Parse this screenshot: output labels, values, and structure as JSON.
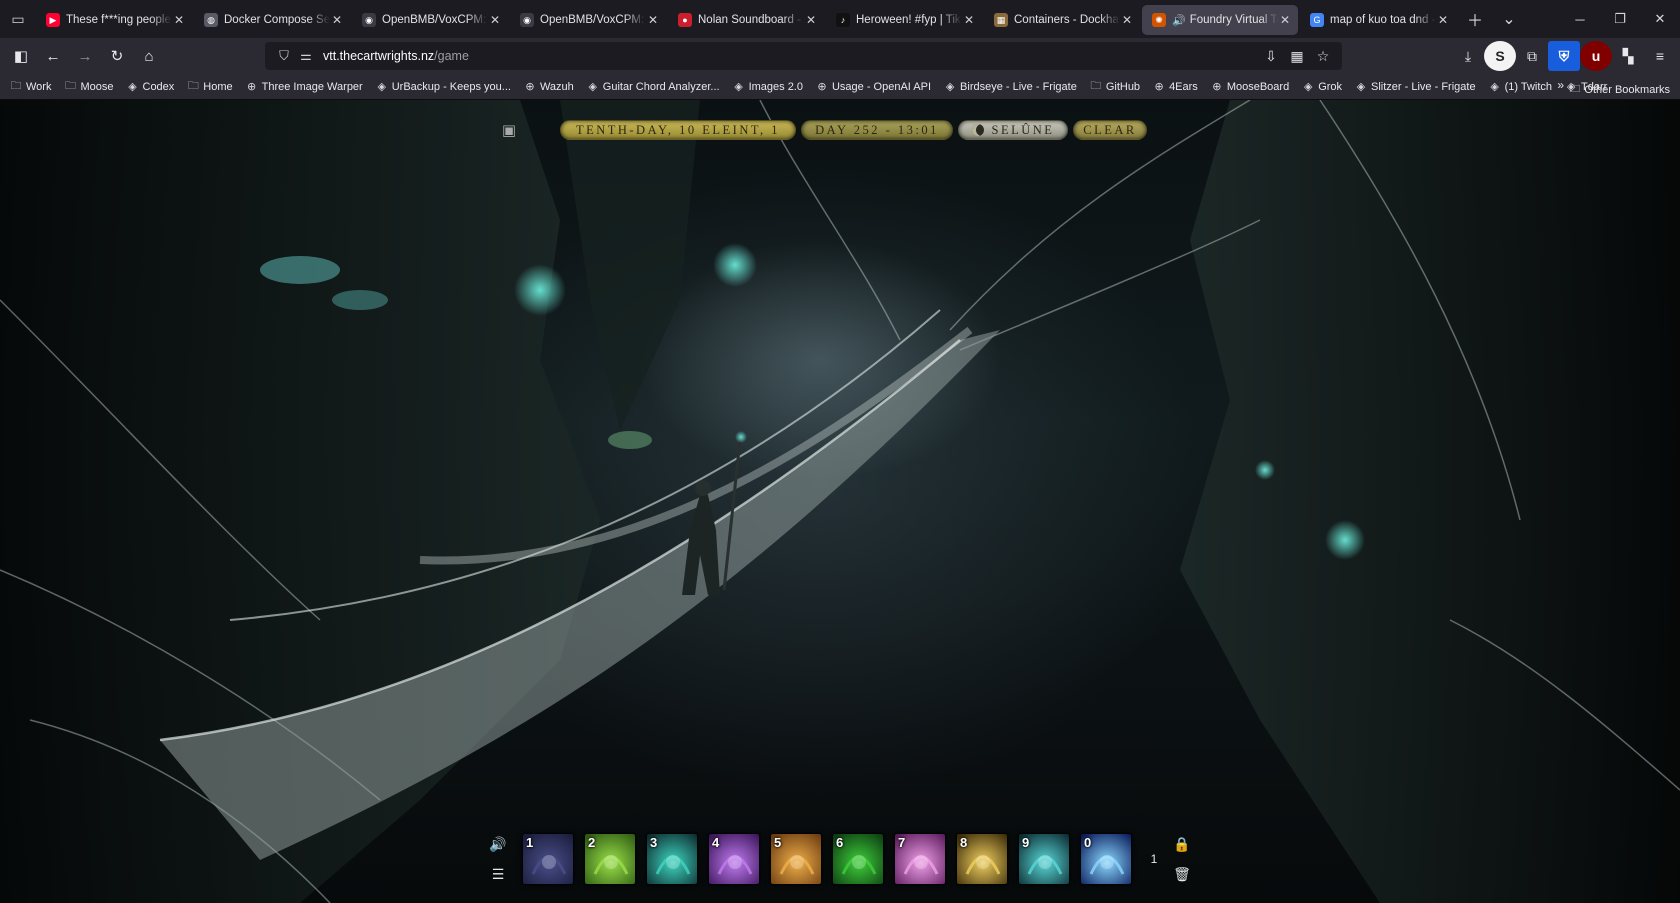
{
  "browser": {
    "tabs": [
      {
        "title": "These f***ing people, n",
        "favicon_color": "#ff0033",
        "favicon_glyph": "▶"
      },
      {
        "title": "Docker Compose Setup",
        "favicon_color": "#5a5a66",
        "favicon_glyph": "◍"
      },
      {
        "title": "OpenBMB/VoxCPM: Vo",
        "favicon_color": "#3a3a44",
        "favicon_glyph": "◉"
      },
      {
        "title": "OpenBMB/VoxCPM: Vo",
        "favicon_color": "#3a3a44",
        "favicon_glyph": "◉"
      },
      {
        "title": "Nolan Soundboard - In",
        "favicon_color": "#cc1f2d",
        "favicon_glyph": "●"
      },
      {
        "title": "Heroween! #fyp | TikTo",
        "favicon_color": "#111111",
        "favicon_glyph": "♪"
      },
      {
        "title": "Containers - Dockhand",
        "favicon_color": "#8a6a3a",
        "favicon_glyph": "▦"
      },
      {
        "title": "Foundry Virtual Tab",
        "favicon_color": "#d35400",
        "favicon_glyph": "✺",
        "active": true,
        "playing_audio": true
      },
      {
        "title": "map of kuo toa dnd - G",
        "favicon_color": "#4285f4",
        "favicon_glyph": "G"
      }
    ],
    "url_host": "vtt.thecartwrights.nz",
    "url_path": "/game",
    "bookmarks": [
      {
        "label": "Work",
        "icon": "folder-icon"
      },
      {
        "label": "Moose",
        "icon": "folder-icon"
      },
      {
        "label": "Codex",
        "icon": "app-icon"
      },
      {
        "label": "Home",
        "icon": "folder-icon"
      },
      {
        "label": "Three Image Warper",
        "icon": "globe-icon"
      },
      {
        "label": "UrBackup - Keeps you...",
        "icon": "app-icon"
      },
      {
        "label": "Wazuh",
        "icon": "globe-icon"
      },
      {
        "label": "Guitar Chord Analyzer...",
        "icon": "app-icon"
      },
      {
        "label": "Images 2.0",
        "icon": "app-icon"
      },
      {
        "label": "Usage - OpenAI API",
        "icon": "globe-icon"
      },
      {
        "label": "Birdseye - Live - Frigate",
        "icon": "app-icon"
      },
      {
        "label": "GitHub",
        "icon": "folder-icon"
      },
      {
        "label": "4Ears",
        "icon": "globe-icon"
      },
      {
        "label": "MooseBoard",
        "icon": "globe-icon"
      },
      {
        "label": "Grok",
        "icon": "app-icon"
      },
      {
        "label": "Slitzer - Live - Frigate",
        "icon": "app-icon"
      },
      {
        "label": "(1) Twitch",
        "icon": "app-icon"
      },
      {
        "label": "Tdarr",
        "icon": "app-icon"
      }
    ],
    "other_bookmarks": "Other Bookmarks"
  },
  "game": {
    "calendar": {
      "date": "TENTH-DAY, 10 ELEINT, 1",
      "time": "DAY 252 - 13:01",
      "moon": "SELÛNE",
      "weather": "CLEAR"
    },
    "hotbar": {
      "page": "1",
      "slots": [
        {
          "number": "1",
          "icon": "dark-wings-icon",
          "colors": [
            "#1a1c3a",
            "#4a4f8a"
          ]
        },
        {
          "number": "2",
          "icon": "acid-splash-icon",
          "colors": [
            "#2d5a12",
            "#9be04a"
          ]
        },
        {
          "number": "3",
          "icon": "healing-heart-icon",
          "colors": [
            "#0d2a2e",
            "#3ed6c0"
          ]
        },
        {
          "number": "4",
          "icon": "arcane-rune-icon",
          "colors": [
            "#3a1458",
            "#c07cf0"
          ]
        },
        {
          "number": "5",
          "icon": "strength-arm-icon",
          "colors": [
            "#6a3a10",
            "#f0b04a"
          ]
        },
        {
          "number": "6",
          "icon": "green-burst-icon",
          "colors": [
            "#0c3a12",
            "#3fcf3a"
          ]
        },
        {
          "number": "7",
          "icon": "pink-wave-icon",
          "colors": [
            "#5a1a5a",
            "#f0a0e8"
          ]
        },
        {
          "number": "8",
          "icon": "golden-sparks-icon",
          "colors": [
            "#3a2a08",
            "#f0d060"
          ]
        },
        {
          "number": "9",
          "icon": "spirit-stag-icon",
          "colors": [
            "#0a2a30",
            "#5ad8d8"
          ]
        },
        {
          "number": "0",
          "icon": "lightning-bolt-icon",
          "colors": [
            "#0a1a5a",
            "#8ad8ff"
          ]
        }
      ]
    }
  }
}
